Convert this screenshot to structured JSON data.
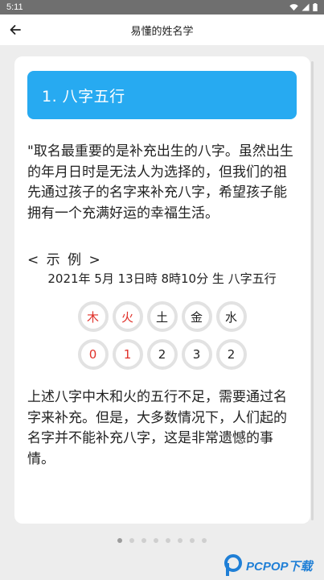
{
  "status_bar": {
    "time": "5:11"
  },
  "app_bar": {
    "title": "易懂的姓名学"
  },
  "card": {
    "section_title": "1. 八字五行",
    "intro": "\"取名最重要的是补充出生的八字。虽然出生的年月日时是无法人为选择的，但我们的祖先通过孩子的名字来补充八字，希望孩子能拥有一个充满好运的幸福生活。",
    "example_label": "< 示 例 >",
    "example_date": "2021年 5月 13日時 8時10分 生 八字五行",
    "elements": [
      {
        "label": "木",
        "count": "0",
        "deficient": true
      },
      {
        "label": "火",
        "count": "1",
        "deficient": true
      },
      {
        "label": "土",
        "count": "2",
        "deficient": false
      },
      {
        "label": "金",
        "count": "3",
        "deficient": false
      },
      {
        "label": "水",
        "count": "2",
        "deficient": false
      }
    ],
    "conclusion": "上述八字中木和火的五行不足，需要通过名字来补充。但是，大多数情况下，人们起的名字并不能补充八字，这是非常遗憾的事情。"
  },
  "pager": {
    "total": 8,
    "active_index": 0
  },
  "watermark": {
    "text": "PCPOP下载"
  },
  "colors": {
    "header_bg": "#27aaf1",
    "deficient_text": "#e0312a",
    "circle_border": "#e2e2e2"
  }
}
